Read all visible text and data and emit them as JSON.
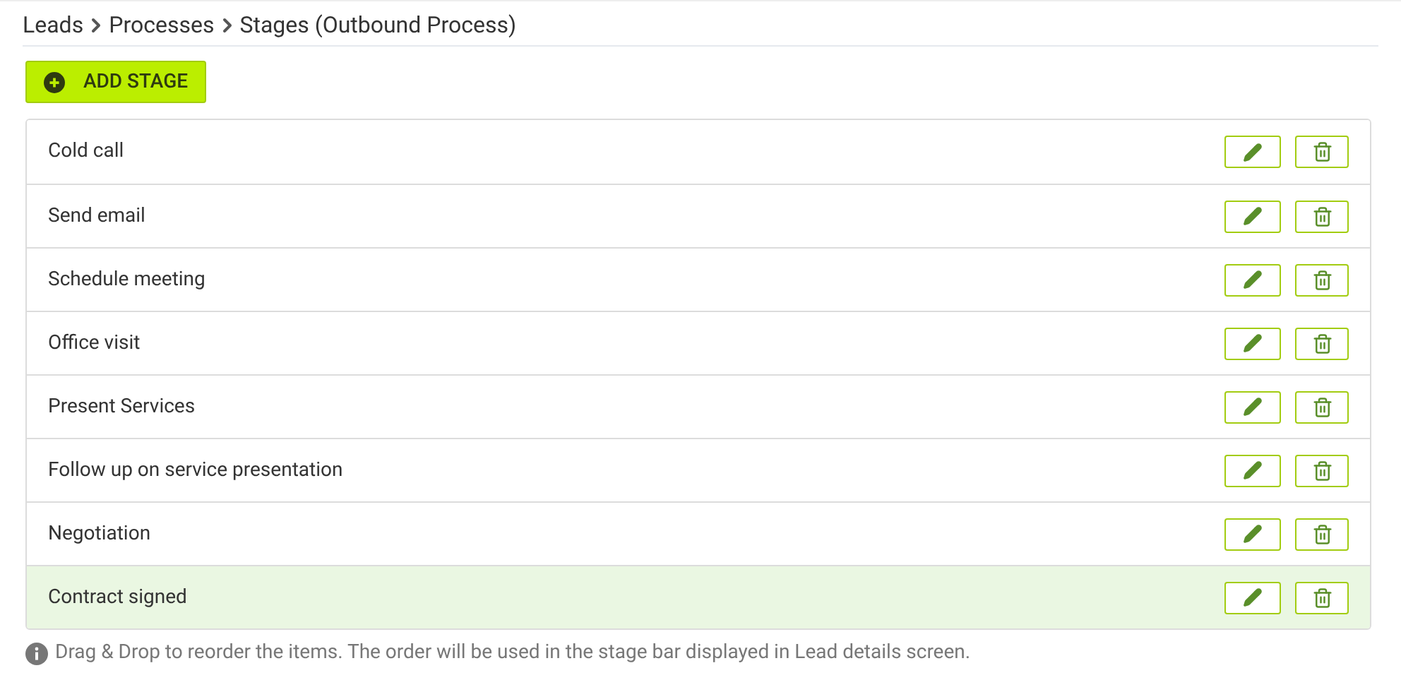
{
  "breadcrumb": [
    "Leads",
    "Processes",
    "Stages (Outbound Process)"
  ],
  "add_button": "ADD STAGE",
  "stages": [
    {
      "name": "Cold call",
      "selected": false
    },
    {
      "name": "Send email",
      "selected": false
    },
    {
      "name": "Schedule meeting",
      "selected": false
    },
    {
      "name": "Office visit",
      "selected": false
    },
    {
      "name": "Present Services",
      "selected": false
    },
    {
      "name": "Follow up on service presentation",
      "selected": false
    },
    {
      "name": "Negotiation",
      "selected": false
    },
    {
      "name": "Contract signed",
      "selected": true
    }
  ],
  "hint": "Drag & Drop to reorder the items. The order will be used in the stage bar displayed in Lead details screen."
}
